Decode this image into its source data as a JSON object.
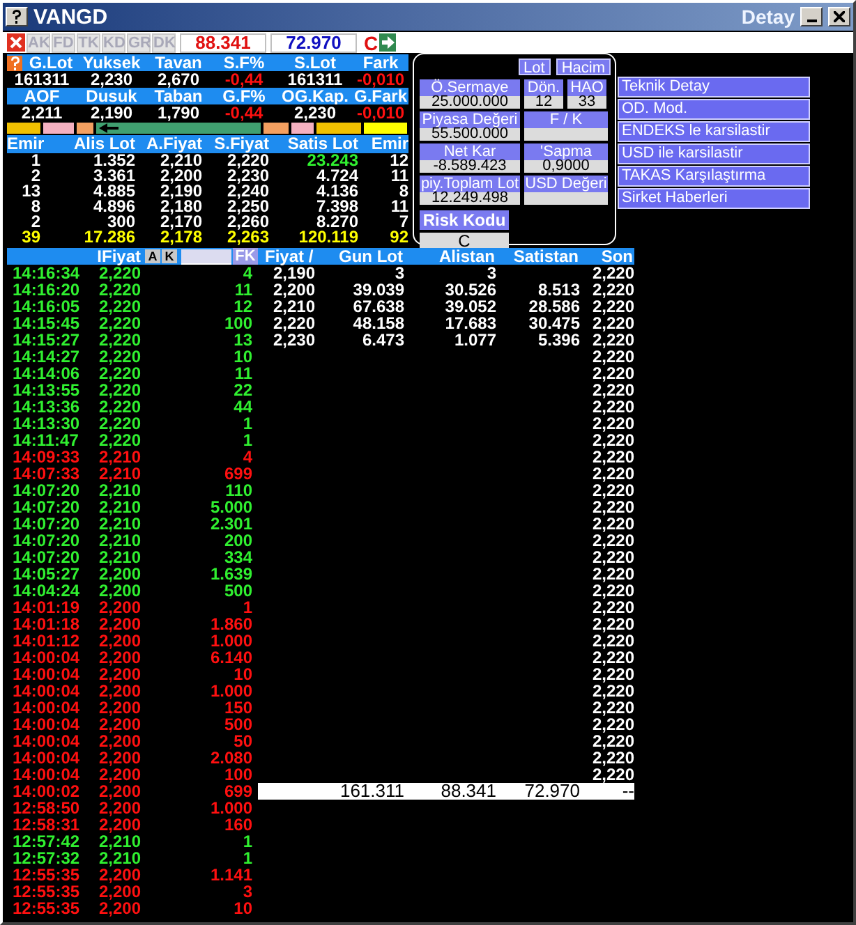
{
  "window": {
    "title": "VANGD",
    "caption": "Detay"
  },
  "toolbar": {
    "tabs": [
      {
        "label": "AK",
        "disabled": true
      },
      {
        "label": "FD",
        "disabled": true
      },
      {
        "label": "TK",
        "disabled": true
      },
      {
        "label": "KD",
        "disabled": true
      },
      {
        "label": "GR",
        "disabled": true
      },
      {
        "label": "DK",
        "disabled": true
      }
    ],
    "fields": [
      {
        "kind": "sell",
        "value": "88.341"
      },
      {
        "kind": "buy",
        "value": "72.970"
      }
    ],
    "code": "C"
  },
  "summary": [
    {
      "kind": "header",
      "cells": [
        {
          "text": "G.Lot",
          "negative": false
        },
        {
          "text": "Yuksek",
          "negative": false
        },
        {
          "text": "Tavan",
          "negative": false
        },
        {
          "text": "S.F%",
          "negative": false
        },
        {
          "text": "S.Lot",
          "negative": false
        },
        {
          "text": "Fark",
          "negative": false
        }
      ]
    },
    {
      "kind": "values",
      "cells": [
        {
          "text": "161311",
          "negative": false
        },
        {
          "text": "2,230",
          "negative": false
        },
        {
          "text": "2,670",
          "negative": false
        },
        {
          "text": "-0,44",
          "negative": true
        },
        {
          "text": "161311",
          "negative": false
        },
        {
          "text": "-0,010",
          "negative": true
        }
      ]
    },
    {
      "kind": "header",
      "cells": [
        {
          "text": "AOF",
          "negative": false
        },
        {
          "text": "Dusuk",
          "negative": false
        },
        {
          "text": "Taban",
          "negative": false
        },
        {
          "text": "G.F%",
          "negative": false
        },
        {
          "text": "OG.Kap.",
          "negative": false
        },
        {
          "text": "G.Fark",
          "negative": false
        }
      ]
    },
    {
      "kind": "values",
      "cells": [
        {
          "text": "2,211",
          "negative": false
        },
        {
          "text": "2,190",
          "negative": false
        },
        {
          "text": "1,790",
          "negative": false
        },
        {
          "text": "-0,44",
          "negative": true
        },
        {
          "text": "2,230",
          "negative": false
        },
        {
          "text": "-0,010",
          "negative": true
        }
      ]
    }
  ],
  "order_book": {
    "columns": [
      "Emir",
      "Alis Lot",
      "A.Fiyat",
      "S.Fiyat",
      "Satis Lot",
      "Emir"
    ],
    "rows": [
      {
        "kind": "level",
        "cells": [
          {
            "text": "1",
            "highlight": false
          },
          {
            "text": "1.352",
            "highlight": false
          },
          {
            "text": "2,210",
            "highlight": false
          },
          {
            "text": "2,220",
            "highlight": false
          },
          {
            "text": "23.243",
            "highlight": true
          },
          {
            "text": "12",
            "highlight": false
          }
        ]
      },
      {
        "kind": "level",
        "cells": [
          {
            "text": "2",
            "highlight": false
          },
          {
            "text": "3.361",
            "highlight": false
          },
          {
            "text": "2,200",
            "highlight": false
          },
          {
            "text": "2,230",
            "highlight": false
          },
          {
            "text": "4.724",
            "highlight": false
          },
          {
            "text": "11",
            "highlight": false
          }
        ]
      },
      {
        "kind": "level",
        "cells": [
          {
            "text": "13",
            "highlight": false
          },
          {
            "text": "4.885",
            "highlight": false
          },
          {
            "text": "2,190",
            "highlight": false
          },
          {
            "text": "2,240",
            "highlight": false
          },
          {
            "text": "4.136",
            "highlight": false
          },
          {
            "text": "8",
            "highlight": false
          }
        ]
      },
      {
        "kind": "level",
        "cells": [
          {
            "text": "8",
            "highlight": false
          },
          {
            "text": "4.896",
            "highlight": false
          },
          {
            "text": "2,180",
            "highlight": false
          },
          {
            "text": "2,250",
            "highlight": false
          },
          {
            "text": "7.398",
            "highlight": false
          },
          {
            "text": "11",
            "highlight": false
          }
        ]
      },
      {
        "kind": "level",
        "cells": [
          {
            "text": "2",
            "highlight": false
          },
          {
            "text": "300",
            "highlight": false
          },
          {
            "text": "2,170",
            "highlight": false
          },
          {
            "text": "2,260",
            "highlight": false
          },
          {
            "text": "8.270",
            "highlight": false
          },
          {
            "text": "7",
            "highlight": false
          }
        ]
      },
      {
        "kind": "total",
        "cells": [
          {
            "text": "39",
            "highlight": false
          },
          {
            "text": "17.286",
            "highlight": false
          },
          {
            "text": "2,178",
            "highlight": false
          },
          {
            "text": "2,263",
            "highlight": false
          },
          {
            "text": "120.119",
            "highlight": false
          },
          {
            "text": "92",
            "highlight": false
          }
        ]
      }
    ]
  },
  "fundamentals": {
    "toggles": [
      {
        "label": "Lot"
      },
      {
        "label": "Hacim"
      }
    ],
    "rows": [
      [
        {
          "label": "Ö.Sermaye",
          "value": "25.000.000",
          "kind": "wide"
        },
        {
          "label": "Dön.",
          "value": "12",
          "kind": "narrow"
        },
        {
          "label": "HAO",
          "value": "33",
          "kind": "narrow"
        }
      ],
      [
        {
          "label": "Piyasa Değeri",
          "value": "55.500.000",
          "kind": "wide"
        },
        {
          "label": "F / K",
          "kind": "medium"
        }
      ],
      [
        {
          "label": "Net Kar",
          "value": "-8.589.423",
          "kind": "wide"
        },
        {
          "label": "'Sapma",
          "value": "0,9000",
          "kind": "medium"
        }
      ],
      [
        {
          "label": "piy.Toplam Lot",
          "value": "12.249.498",
          "kind": "wide"
        },
        {
          "label": "USD Değeri",
          "kind": "medium"
        }
      ]
    ],
    "risk": {
      "label": "Risk Kodu",
      "value": "C"
    }
  },
  "links": [
    "Teknik Detay",
    "OD. Mod.",
    "ENDEKS le karsilastir",
    "USD ile karsilastir",
    "TAKAS Karşılaştırma",
    "Sirket Haberleri"
  ],
  "trades": {
    "header": {
      "label": "IFiyat",
      "buttons": [
        "A",
        "K"
      ],
      "filter": "FK"
    },
    "rows": [
      {
        "time": "14:16:34",
        "price": "2,220",
        "lot": "4",
        "rising": true
      },
      {
        "time": "14:16:20",
        "price": "2,220",
        "lot": "11",
        "rising": true
      },
      {
        "time": "14:16:05",
        "price": "2,220",
        "lot": "12",
        "rising": true
      },
      {
        "time": "14:15:45",
        "price": "2,220",
        "lot": "100",
        "rising": true
      },
      {
        "time": "14:15:27",
        "price": "2,220",
        "lot": "13",
        "rising": true
      },
      {
        "time": "14:14:27",
        "price": "2,220",
        "lot": "10",
        "rising": true
      },
      {
        "time": "14:14:06",
        "price": "2,220",
        "lot": "11",
        "rising": true
      },
      {
        "time": "14:13:55",
        "price": "2,220",
        "lot": "22",
        "rising": true
      },
      {
        "time": "14:13:36",
        "price": "2,220",
        "lot": "44",
        "rising": true
      },
      {
        "time": "14:13:30",
        "price": "2,220",
        "lot": "1",
        "rising": true
      },
      {
        "time": "14:11:47",
        "price": "2,220",
        "lot": "1",
        "rising": true
      },
      {
        "time": "14:09:33",
        "price": "2,210",
        "lot": "4",
        "rising": false
      },
      {
        "time": "14:07:33",
        "price": "2,210",
        "lot": "699",
        "rising": false
      },
      {
        "time": "14:07:20",
        "price": "2,210",
        "lot": "110",
        "rising": true
      },
      {
        "time": "14:07:20",
        "price": "2,210",
        "lot": "5.000",
        "rising": true
      },
      {
        "time": "14:07:20",
        "price": "2,210",
        "lot": "2.301",
        "rising": true
      },
      {
        "time": "14:07:20",
        "price": "2,210",
        "lot": "200",
        "rising": true
      },
      {
        "time": "14:07:20",
        "price": "2,210",
        "lot": "334",
        "rising": true
      },
      {
        "time": "14:05:27",
        "price": "2,200",
        "lot": "1.639",
        "rising": true
      },
      {
        "time": "14:04:24",
        "price": "2,200",
        "lot": "500",
        "rising": true
      },
      {
        "time": "14:01:19",
        "price": "2,200",
        "lot": "1",
        "rising": false
      },
      {
        "time": "14:01:18",
        "price": "2,200",
        "lot": "1.860",
        "rising": false
      },
      {
        "time": "14:01:12",
        "price": "2,200",
        "lot": "1.000",
        "rising": false
      },
      {
        "time": "14:00:04",
        "price": "2,200",
        "lot": "6.140",
        "rising": false
      },
      {
        "time": "14:00:04",
        "price": "2,200",
        "lot": "10",
        "rising": false
      },
      {
        "time": "14:00:04",
        "price": "2,200",
        "lot": "1.000",
        "rising": false
      },
      {
        "time": "14:00:04",
        "price": "2,200",
        "lot": "150",
        "rising": false
      },
      {
        "time": "14:00:04",
        "price": "2,200",
        "lot": "500",
        "rising": false
      },
      {
        "time": "14:00:04",
        "price": "2,200",
        "lot": "50",
        "rising": false
      },
      {
        "time": "14:00:04",
        "price": "2,200",
        "lot": "2.080",
        "rising": false
      },
      {
        "time": "14:00:04",
        "price": "2,200",
        "lot": "100",
        "rising": false
      },
      {
        "time": "14:00:02",
        "price": "2,200",
        "lot": "699",
        "rising": false
      },
      {
        "time": "12:58:50",
        "price": "2,200",
        "lot": "1.000",
        "rising": false
      },
      {
        "time": "12:58:31",
        "price": "2,200",
        "lot": "160",
        "rising": false
      },
      {
        "time": "12:57:42",
        "price": "2,210",
        "lot": "1",
        "rising": true
      },
      {
        "time": "12:57:32",
        "price": "2,210",
        "lot": "1",
        "rising": true
      },
      {
        "time": "12:55:35",
        "price": "2,200",
        "lot": "1.141",
        "rising": false
      },
      {
        "time": "12:55:35",
        "price": "2,200",
        "lot": "3",
        "rising": false
      },
      {
        "time": "12:55:35",
        "price": "2,200",
        "lot": "10",
        "rising": false
      }
    ]
  },
  "price_levels": {
    "columns": [
      "Fiyat /",
      "Gun Lot",
      "Alistan",
      "Satistan",
      "Son"
    ],
    "rows": [
      {
        "price": "2,190",
        "gun_lot": "3",
        "alistan": "3",
        "son": "2,220"
      },
      {
        "price": "2,200",
        "gun_lot": "39.039",
        "alistan": "30.526",
        "satistan": "8.513",
        "son": "2,220"
      },
      {
        "price": "2,210",
        "gun_lot": "67.638",
        "alistan": "39.052",
        "satistan": "28.586",
        "son": "2,220"
      },
      {
        "price": "2,220",
        "gun_lot": "48.158",
        "alistan": "17.683",
        "satistan": "30.475",
        "son": "2,220"
      },
      {
        "price": "2,230",
        "gun_lot": "6.473",
        "alistan": "1.077",
        "satistan": "5.396",
        "son": "2,220"
      },
      {
        "son": "2,220"
      },
      {
        "son": "2,220"
      },
      {
        "son": "2,220"
      },
      {
        "son": "2,220"
      },
      {
        "son": "2,220"
      },
      {
        "son": "2,220"
      },
      {
        "son": "2,220"
      },
      {
        "son": "2,220"
      },
      {
        "son": "2,220"
      },
      {
        "son": "2,220"
      },
      {
        "son": "2,220"
      },
      {
        "son": "2,220"
      },
      {
        "son": "2,220"
      },
      {
        "son": "2,220"
      },
      {
        "son": "2,220"
      },
      {
        "son": "2,220"
      },
      {
        "son": "2,220"
      },
      {
        "son": "2,220"
      },
      {
        "son": "2,220"
      },
      {
        "son": "2,220"
      },
      {
        "son": "2,220"
      },
      {
        "son": "2,220"
      },
      {
        "son": "2,220"
      },
      {
        "son": "2,220"
      },
      {
        "son": "2,220"
      },
      {
        "son": "2,220"
      }
    ],
    "total": {
      "gun_lot": "161.311",
      "alistan": "88.341",
      "satistan": "72.970",
      "son": "--"
    }
  }
}
